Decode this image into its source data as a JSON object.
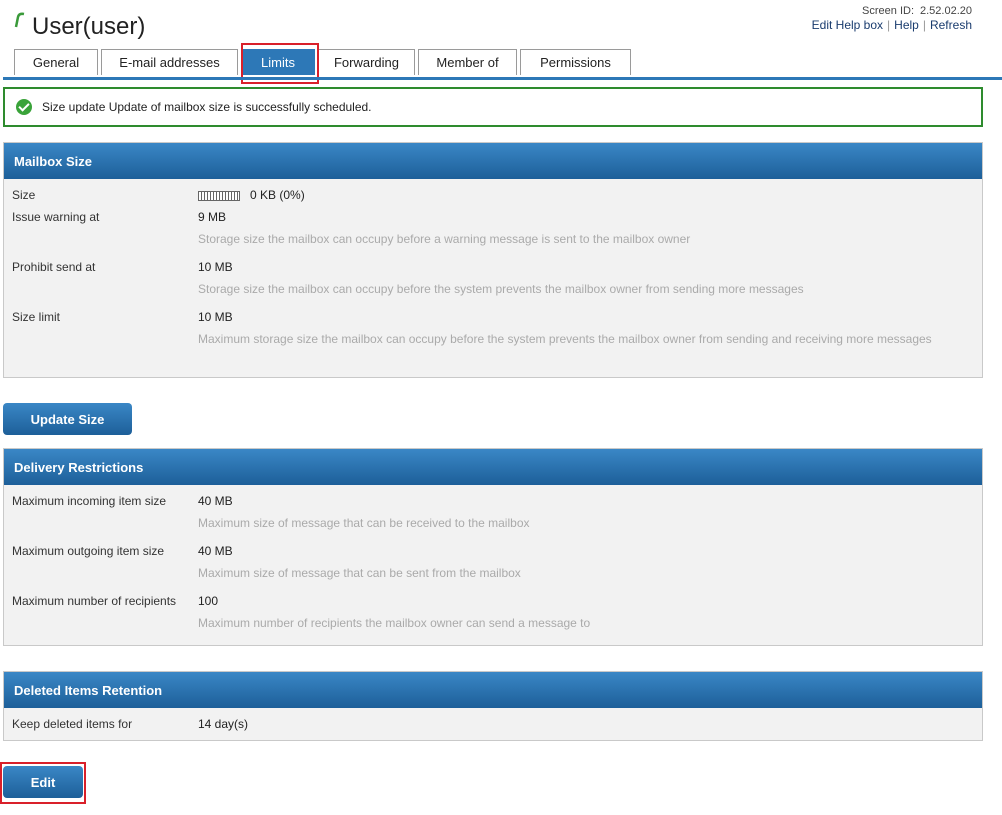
{
  "header": {
    "title": "User(user)",
    "screen_id_label": "Screen ID:",
    "screen_id_value": "2.52.02.20",
    "links": [
      "Edit Help box",
      "Help",
      "Refresh"
    ]
  },
  "tabs": [
    {
      "label": "General",
      "active": false
    },
    {
      "label": "E-mail addresses",
      "active": false
    },
    {
      "label": "Limits",
      "active": true
    },
    {
      "label": "Forwarding",
      "active": false
    },
    {
      "label": "Member of",
      "active": false
    },
    {
      "label": "Permissions",
      "active": false
    }
  ],
  "message": {
    "text": "Size update Update of mailbox size is successfully scheduled."
  },
  "mailbox_size": {
    "title": "Mailbox Size",
    "size_label": "Size",
    "size_value": "0 KB (0%)",
    "size_fraction": 0,
    "warning_label": "Issue warning at",
    "warning_value": "9 MB",
    "warning_hint": "Storage size the mailbox can occupy before a warning message is sent to the mailbox owner",
    "prohibit_label": "Prohibit send at",
    "prohibit_value": "10 MB",
    "prohibit_hint": "Storage size the mailbox can occupy before the system prevents the mailbox owner from sending more messages",
    "limit_label": "Size limit",
    "limit_value": "10 MB",
    "limit_hint": "Maximum storage size the mailbox can occupy before the system prevents the mailbox owner from sending and receiving more messages"
  },
  "update_button": "Update Size",
  "delivery": {
    "title": "Delivery Restrictions",
    "incoming_label": "Maximum incoming item size",
    "incoming_value": "40 MB",
    "incoming_hint": "Maximum size of message that can be received to the mailbox",
    "outgoing_label": "Maximum outgoing item size",
    "outgoing_value": "40 MB",
    "outgoing_hint": "Maximum size of message that can be sent from the mailbox",
    "recipients_label": "Maximum number of recipients",
    "recipients_value": "100",
    "recipients_hint": "Maximum number of recipients the mailbox owner can send a message to"
  },
  "retention": {
    "title": "Deleted Items Retention",
    "keep_label": "Keep deleted items for",
    "keep_value": "14 day(s)"
  },
  "edit_button": "Edit",
  "colors": {
    "accent": "#2d78b7",
    "success": "#2e8b2e",
    "highlight": "#d9202a"
  }
}
